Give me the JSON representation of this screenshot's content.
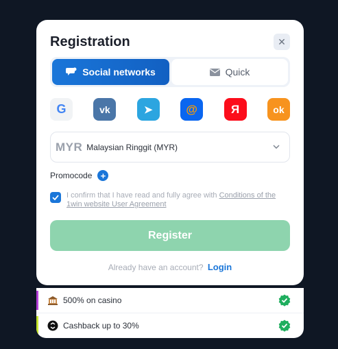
{
  "modal": {
    "title": "Registration",
    "close_glyph": "✕"
  },
  "tabs": [
    {
      "label": "Social networks",
      "icon": "chat-icon",
      "active": true
    },
    {
      "label": "Quick",
      "icon": "envelope-icon",
      "active": false
    }
  ],
  "social_providers": [
    {
      "name": "google",
      "glyph": "G",
      "bg": "#f1f3f5",
      "color": "#4285f4"
    },
    {
      "name": "vk",
      "glyph": "vk",
      "bg": "#4a76a8",
      "color": "#ffffff"
    },
    {
      "name": "telegram",
      "glyph": "➤",
      "bg": "#2ca5e0",
      "color": "#ffffff"
    },
    {
      "name": "mail-ru",
      "glyph": "@",
      "bg": "#0a66f0",
      "color": "#ff9e00"
    },
    {
      "name": "yandex",
      "glyph": "Я",
      "bg": "#fc0d1b",
      "color": "#ffffff"
    },
    {
      "name": "odnoklassniki",
      "glyph": "ok",
      "bg": "#f7931e",
      "color": "#ffffff"
    }
  ],
  "currency": {
    "code": "MYR",
    "name": "Malaysian Ringgit (MYR)"
  },
  "promocode": {
    "label": "Promocode",
    "plus": "+"
  },
  "agreement": {
    "checked": true,
    "text": "I confirm that I have read and fully agree with ",
    "link_text": "Conditions of the 1win website User Agreement"
  },
  "register": {
    "label": "Register"
  },
  "login_prompt": {
    "text": "Already have an account?",
    "link": "Login"
  },
  "bonuses": [
    {
      "label": "500% on casino",
      "icon": "casino-icon",
      "bar_color": "#b43fd9"
    },
    {
      "label": "Cashback up to 30%",
      "icon": "cashback-icon",
      "bar_color": "#c6e62d"
    }
  ],
  "colors": {
    "accent": "#1a76d9",
    "register_bg": "#8ed4ae",
    "check_green": "#1fae5e"
  }
}
